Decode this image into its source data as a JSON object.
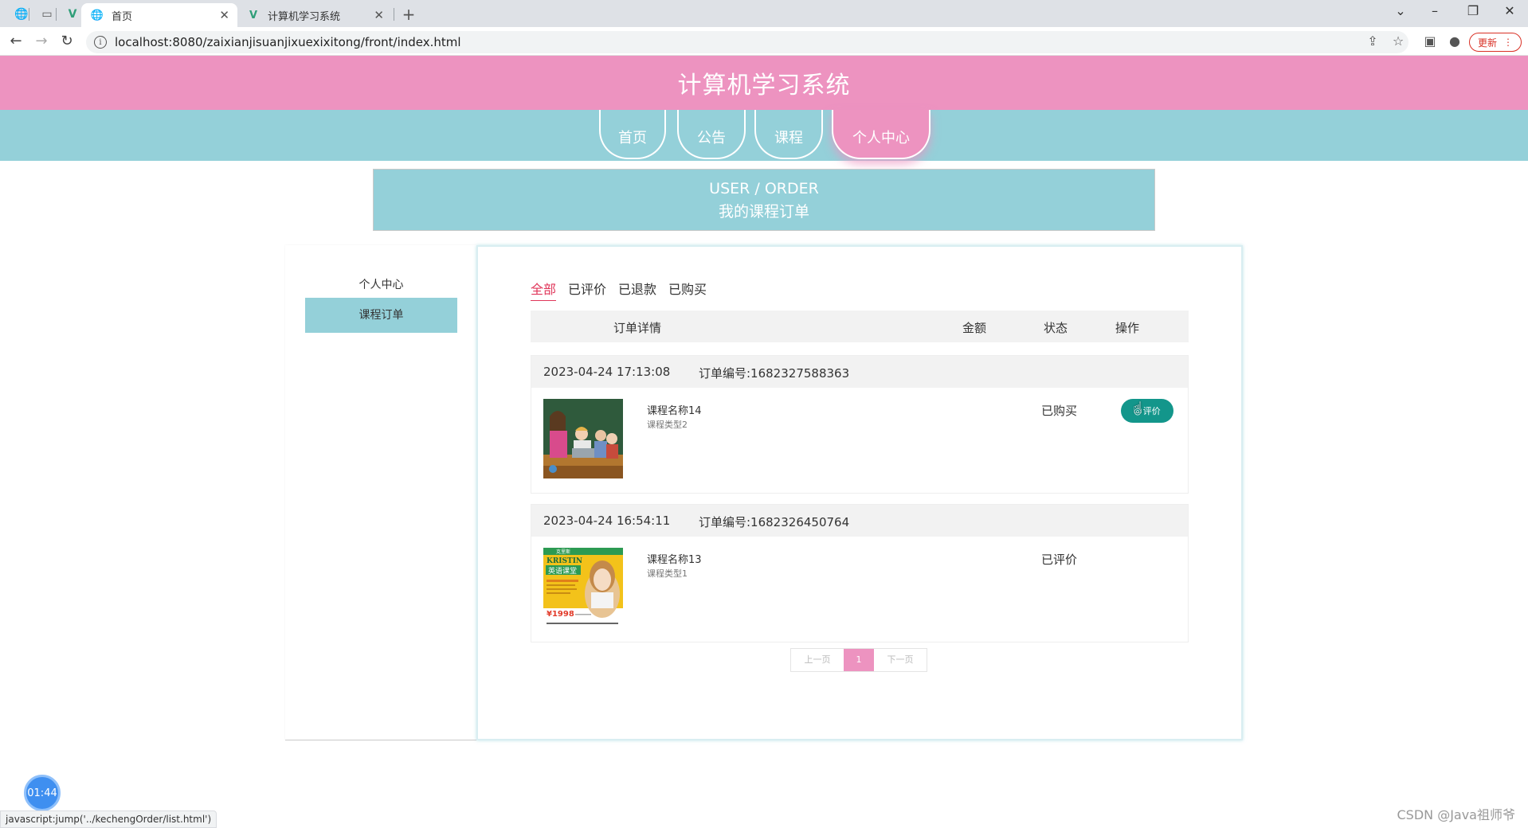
{
  "browser": {
    "tabs": [
      {
        "label": "首页",
        "active": true
      },
      {
        "label": "计算机学习系统",
        "active": false
      }
    ],
    "url": "localhost:8080/zaixianjisuanjixuexixitong/front/index.html",
    "update_label": "更新"
  },
  "site": {
    "title": "计算机学习系统",
    "nav": [
      {
        "label": "首页"
      },
      {
        "label": "公告"
      },
      {
        "label": "课程"
      },
      {
        "label": "个人中心",
        "active": true
      }
    ]
  },
  "banner": {
    "en": "USER / ORDER",
    "cn": "我的课程订单"
  },
  "sidebar": {
    "title": "个人中心",
    "items": [
      {
        "label": "课程订单",
        "active": true
      }
    ]
  },
  "filters": [
    {
      "label": "全部",
      "active": true
    },
    {
      "label": "已评价"
    },
    {
      "label": "已退款"
    },
    {
      "label": "已购买"
    }
  ],
  "table_head": {
    "detail": "订单详情",
    "amount": "金额",
    "status": "状态",
    "action": "操作"
  },
  "orders": [
    {
      "time": "2023-04-24 17:13:08",
      "number": "订单编号:1682327588363",
      "course_name": "课程名称14",
      "course_type": "课程类型2",
      "status": "已购买",
      "action_label": "评价"
    },
    {
      "time": "2023-04-24 16:54:11",
      "number": "订单编号:1682326450764",
      "course_name": "课程名称13",
      "course_type": "课程类型1",
      "status": "已评价",
      "poster": {
        "brand": "KRISTIN",
        "title": "英语课堂",
        "price": "¥1998",
        "header": "克里斯"
      }
    }
  ],
  "pager": {
    "prev": "上一页",
    "current": "1",
    "next": "下一页"
  },
  "timer": "01:44",
  "status_url": "javascript:jump('../kechengOrder/list.html')",
  "watermark": "CSDN @Java祖师爷",
  "colors": {
    "header_pink": "#ed93c0",
    "nav_teal": "#94d0d9",
    "action_green": "#13968b"
  }
}
